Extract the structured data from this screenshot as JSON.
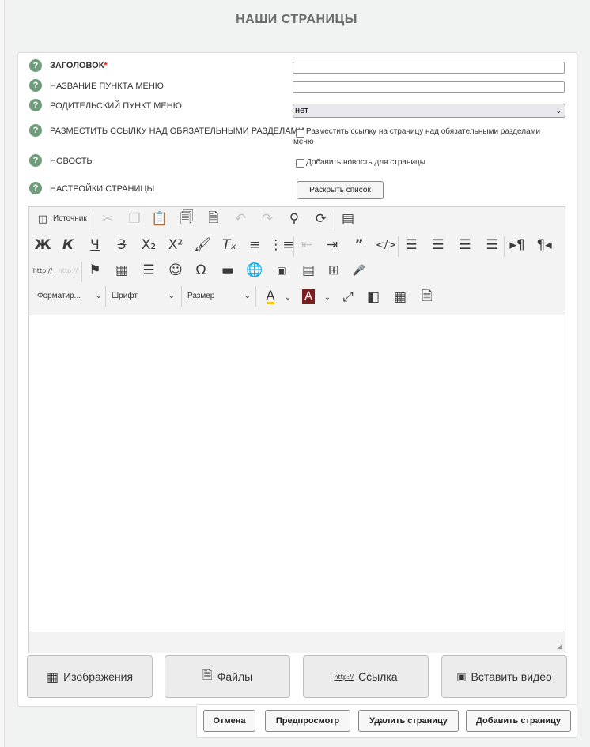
{
  "page": {
    "title": "НАШИ СТРАНИЦЫ"
  },
  "form": {
    "help_mark": "?",
    "required_mark": "*",
    "fields": [
      {
        "label": "ЗАГОЛОВОК",
        "value": ""
      },
      {
        "label": "НАЗВАНИЕ ПУНКТА МЕНЮ",
        "value": ""
      },
      {
        "label": "РОДИТЕЛЬСКИЙ ПУНКТ МЕНЮ",
        "selected": "нет"
      },
      {
        "label": "РАЗМЕСТИТЬ ССЫЛКУ НАД ОБЯЗАТЕЛЬНЫМИ РАЗДЕЛАМИ",
        "checkbox_text_1": "Разместить ссылку на страницу над обязательными разделами",
        "checkbox_text_2": "меню",
        "checked": false
      },
      {
        "label": "НОВОСТЬ",
        "checkbox_text": "Добавить новость для страницы",
        "checked": false
      },
      {
        "label": "НАСТРОЙКИ СТРАНИЦЫ",
        "button": "Раскрыть список"
      }
    ]
  },
  "editor": {
    "source_label": "Источник",
    "format_combo": "Форматир...",
    "font_combo": "Шрифт",
    "size_combo": "Размер",
    "content": ""
  },
  "media_buttons": {
    "images": "Изображения",
    "files": "Файлы",
    "link": "Ссылка",
    "video": "Вставить видео"
  },
  "actions": {
    "cancel": "Отмена",
    "preview": "Предпросмотр",
    "delete": "Удалить страницу",
    "add": "Добавить страницу"
  },
  "colors": {
    "help_icon": "#6f9c7a",
    "required": "#e31b1b",
    "text_color_bar": "#f1c40f",
    "bg_color_icon": "#7a1f1f"
  }
}
